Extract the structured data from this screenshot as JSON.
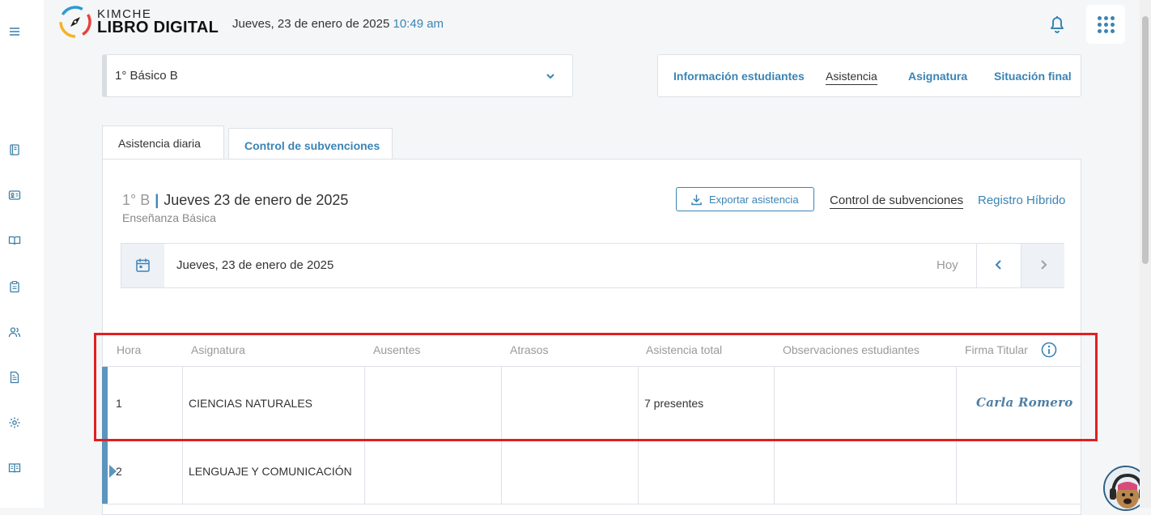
{
  "app": {
    "brand_line1": "KIMCHE",
    "brand_line2": "LIBRO DIGITAL",
    "date_text": "Jueves, 23 de enero de 2025",
    "time_text": "10:49 am"
  },
  "sidebar": {
    "icons": [
      "menu-icon",
      "book-icon",
      "id-card-icon",
      "open-book-icon",
      "clipboard-icon",
      "users-icon",
      "document-icon",
      "settings-icon",
      "book-reader-icon"
    ]
  },
  "course_select": {
    "value": "1° Básico B"
  },
  "nav_tabs": [
    {
      "label": "Información estudiantes"
    },
    {
      "label": "Asistencia"
    },
    {
      "label": "Asignatura"
    },
    {
      "label": "Situación final"
    }
  ],
  "sub_tabs": [
    {
      "label": "Asistencia diaria"
    },
    {
      "label": "Control de subvenciones"
    }
  ],
  "panel": {
    "course_code": "1° B",
    "separator": "|",
    "date_title": "Jueves 23 de enero de 2025",
    "subtitle": "Enseñanza Básica",
    "export_label": "Exportar asistencia",
    "link_subvenciones": "Control de subvenciones",
    "link_hibrido": "Registro Híbrido"
  },
  "datebar": {
    "date_text": "Jueves, 23 de enero de 2025",
    "today_label": "Hoy"
  },
  "table": {
    "headers": [
      "Hora",
      "Asignatura",
      "Ausentes",
      "Atrasos",
      "Asistencia total",
      "Observaciones estudiantes",
      "Firma Titular"
    ],
    "rows": [
      {
        "hora": "1",
        "asignatura": "CIENCIAS NATURALES",
        "ausentes": "",
        "atrasos": "",
        "asistencia": "7 presentes",
        "observaciones": "",
        "firma": "Carla Romero"
      },
      {
        "hora": "2",
        "asignatura": "LENGUAJE Y COMUNICACIÓN",
        "ausentes": "",
        "atrasos": "",
        "asistencia": "",
        "observaciones": "",
        "firma": ""
      }
    ]
  },
  "colors": {
    "accent": "#3b84b4",
    "highlight": "#e02020",
    "row_bar": "#5b95bd"
  }
}
